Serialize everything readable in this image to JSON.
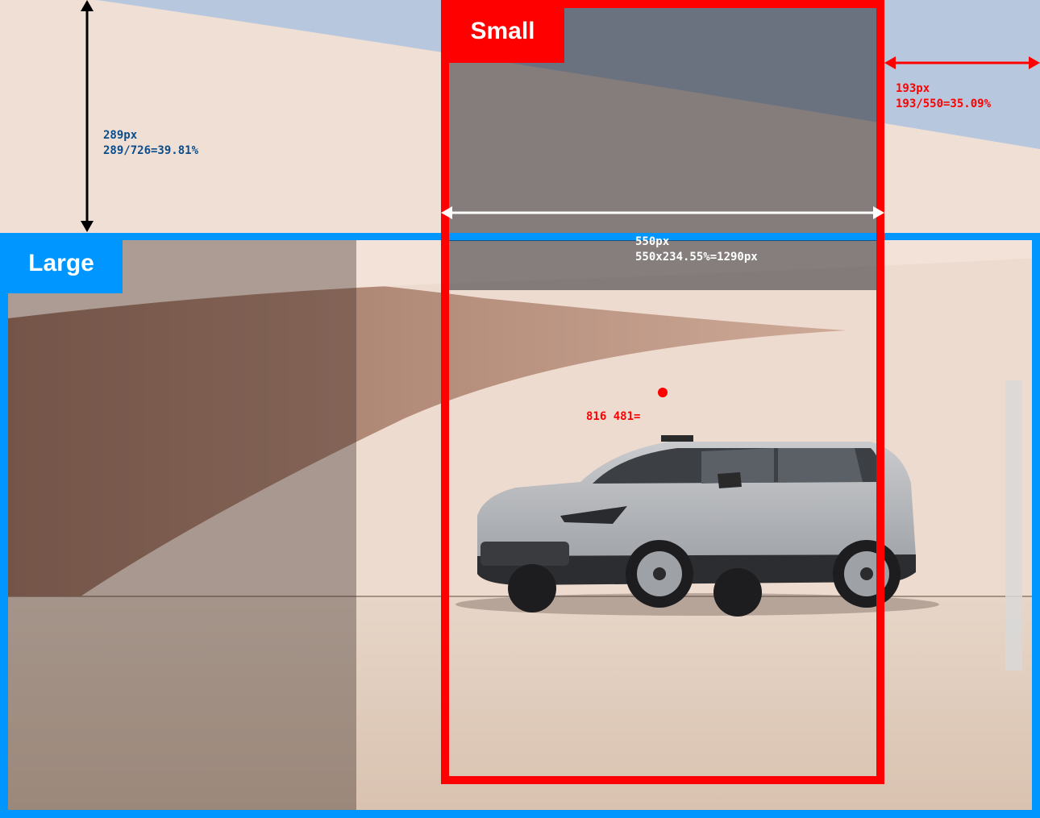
{
  "labels": {
    "large": "Large",
    "small": "Small"
  },
  "dimensions": {
    "vertical_offset": "289px\n289/726=39.81%",
    "right_offset": "193px\n193/550=35.09%",
    "width": "550px\n550x234.55%=1290px",
    "center_point": "816 481="
  },
  "colors": {
    "large_frame": "#0096ff",
    "small_frame": "#ff0000",
    "vertical_text": "#0b4d8a",
    "arrow_black": "#000000",
    "arrow_white": "#ffffff",
    "sky": "#b7c7dd",
    "wall": "#f0dfd4"
  }
}
